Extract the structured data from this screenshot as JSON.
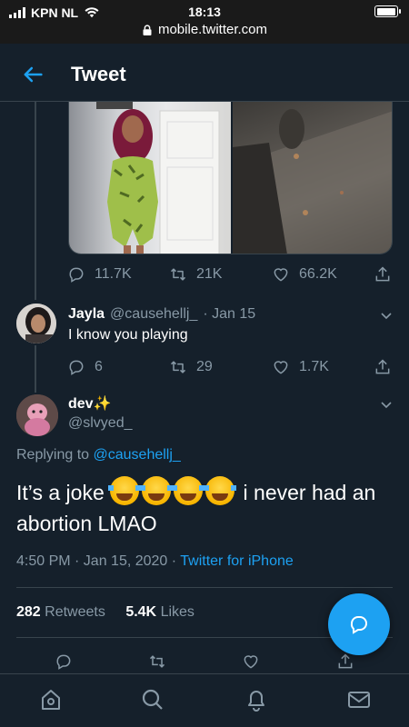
{
  "status": {
    "carrier": "KPN NL",
    "time": "18:13",
    "url": "mobile.twitter.com"
  },
  "header": {
    "title": "Tweet"
  },
  "prev_tweet": {
    "replies": "11.7K",
    "retweets": "21K",
    "likes": "66.2K"
  },
  "reply": {
    "name": "Jayla",
    "handle": "@causehellj_",
    "date": "· Jan 15",
    "text": "I know you playing",
    "replies": "6",
    "retweets": "29",
    "likes": "1.7K"
  },
  "main": {
    "name": "dev",
    "name_emoji": "✨",
    "handle": "@slvyed_",
    "replying_prefix": "Replying to",
    "replying_to": "@causehellj_",
    "text_before": "It’s a joke",
    "text_after": "i never had an abortion LMAO",
    "time": "4:50 PM · Jan 15, 2020 ·",
    "source": "Twitter for iPhone",
    "retweet_count": "282",
    "retweet_label": "Retweets",
    "like_count": "5.4K",
    "like_label": "Likes"
  },
  "colors": {
    "background": "#15202b",
    "accent": "#1da1f2",
    "muted": "#8899a6",
    "border": "#38444d"
  },
  "icons": [
    "wifi-icon",
    "lock-icon",
    "back-arrow-icon",
    "reply-icon",
    "retweet-icon",
    "like-icon",
    "share-icon",
    "chevron-down-icon",
    "compose-reply-icon",
    "home-icon",
    "search-icon",
    "notifications-icon",
    "messages-icon"
  ]
}
